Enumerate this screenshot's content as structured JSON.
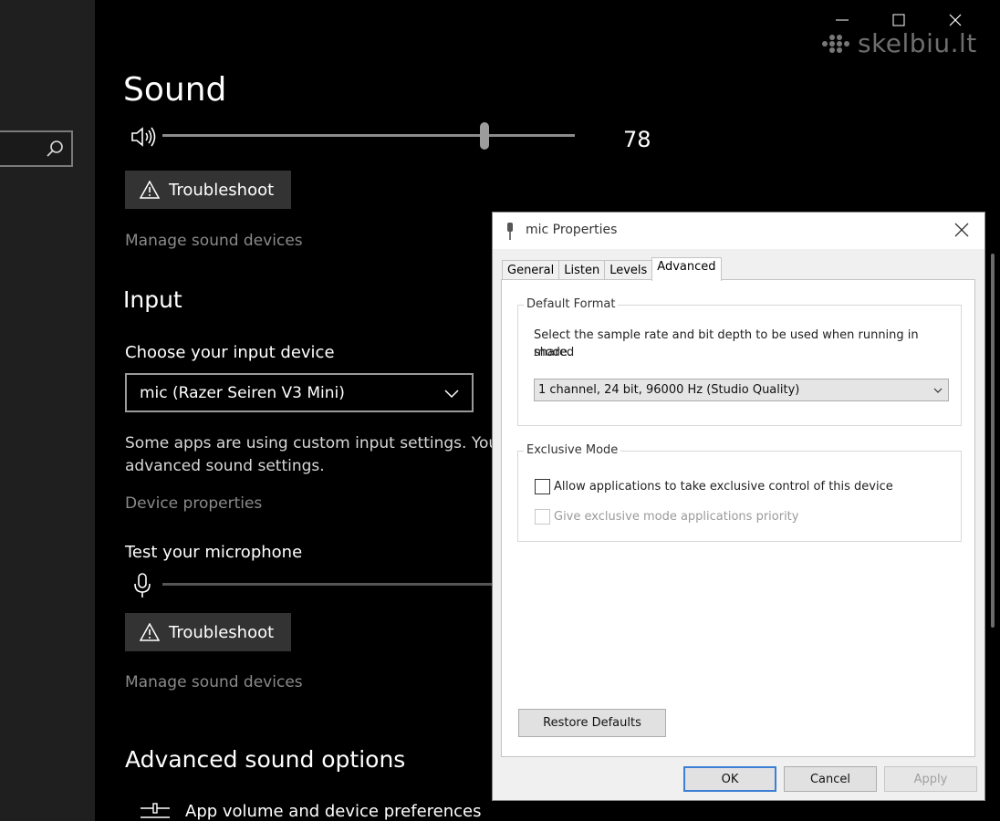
{
  "watermark": {
    "text": "skelbiu.lt"
  },
  "window_controls": [
    "minimize-icon",
    "maximize-icon",
    "close-icon"
  ],
  "sound": {
    "title": "Sound",
    "volume_value": "78",
    "volume_fraction": 0.78,
    "troubleshoot_label": "Troubleshoot",
    "manage_devices_label": "Manage sound devices"
  },
  "input": {
    "title": "Input",
    "choose_label": "Choose your input device",
    "selected_device": "mic (Razer Seiren V3 Mini)",
    "info_line1": "Some apps are using custom input settings. You",
    "info_line2": "advanced sound settings.",
    "device_properties_label": "Device properties",
    "test_label": "Test your microphone",
    "troubleshoot_label": "Troubleshoot",
    "manage_devices_label": "Manage sound devices"
  },
  "advanced": {
    "title": "Advanced sound options",
    "app_volume_label": "App volume and device preferences"
  },
  "dialog": {
    "title": "mic Properties",
    "tabs": [
      {
        "label": "General"
      },
      {
        "label": "Listen"
      },
      {
        "label": "Levels"
      },
      {
        "label": "Advanced",
        "active": true
      }
    ],
    "default_format": {
      "legend": "Default Format",
      "description_line1": "Select the sample rate and bit depth to be used when running in shared",
      "description_line2": "mode.",
      "selected_format": "1 channel, 24 bit, 96000 Hz (Studio Quality)"
    },
    "exclusive_mode": {
      "legend": "Exclusive Mode",
      "allow_label": "Allow applications to take exclusive control of this device",
      "allow_checked": false,
      "priority_label": "Give exclusive mode applications priority",
      "priority_checked": false
    },
    "restore_defaults_label": "Restore Defaults",
    "ok_label": "OK",
    "cancel_label": "Cancel",
    "apply_label": "Apply"
  }
}
